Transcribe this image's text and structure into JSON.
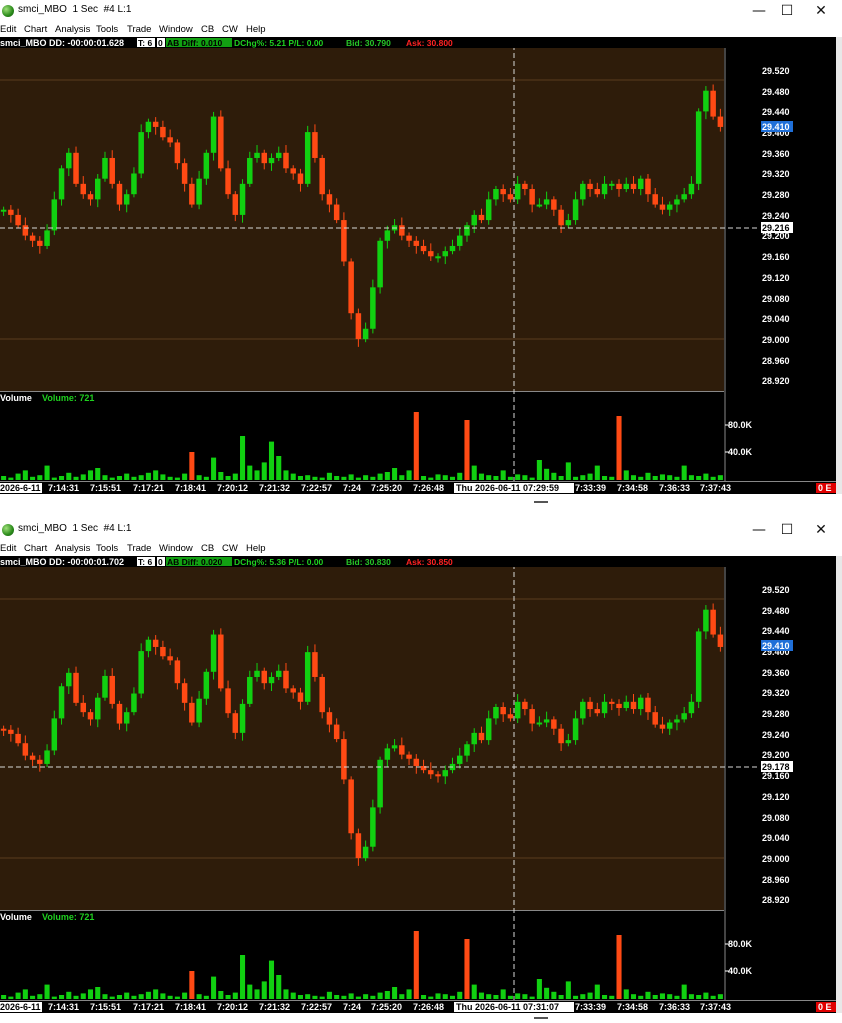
{
  "windows": [
    {
      "title": "smci_MBO  1 Sec  #4 L:1",
      "menu": [
        "Edit",
        "Chart",
        "Analysis",
        "Tools",
        "Trade",
        "Window",
        "CB",
        "CW",
        "Help"
      ],
      "header": {
        "name": "smci_MBO DD: -00:00:01.628",
        "t": "T: 6",
        "zero": "0",
        "ab_diff": "AB Diff: 0.010",
        "dchg": "DChg%: 5.21 P/L: 0.00",
        "bid": "Bid: 30.790",
        "ask": "Ask: 30.800"
      },
      "price_axis": [
        "29.520",
        "29.480",
        "29.440",
        "29.400",
        "29.360",
        "29.320",
        "29.280",
        "29.240",
        "29.200",
        "29.160",
        "29.120",
        "29.080",
        "29.040",
        "29.000",
        "28.960",
        "28.920"
      ],
      "last_price": "29.410",
      "cursor_price": "29.216",
      "volume_label": "Volume",
      "volume_value": "Volume: 721",
      "volume_axis": [
        "80.0K",
        "40.0K"
      ],
      "time_axis": [
        "2026-6-11",
        "7:14:31",
        "7:15:51",
        "7:17:21",
        "7:18:41",
        "7:20:12",
        "7:21:32",
        "7:22:57",
        "7:24",
        "7:25:20",
        "7:26:48",
        "7:33:39",
        "7:34:58",
        "7:36:33",
        "7:37:43"
      ],
      "cursor_time": "Thu 2026-06-11  07:29:59",
      "badge": "0 E",
      "controls": {
        "minimize": "—",
        "maximize": "☐",
        "close": "✕"
      }
    },
    {
      "title": "smci_MBO  1 Sec  #4 L:1",
      "menu": [
        "Edit",
        "Chart",
        "Analysis",
        "Tools",
        "Trade",
        "Window",
        "CB",
        "CW",
        "Help"
      ],
      "header": {
        "name": "smci_MBO DD: -00:00:01.702",
        "t": "T: 6",
        "zero": "0",
        "ab_diff": "AB Diff: 0.020",
        "dchg": "DChg%: 5.36 P/L: 0.00",
        "bid": "Bid: 30.830",
        "ask": "Ask: 30.850"
      },
      "price_axis": [
        "29.520",
        "29.480",
        "29.440",
        "29.400",
        "29.360",
        "29.320",
        "29.280",
        "29.240",
        "29.200",
        "29.160",
        "29.120",
        "29.080",
        "29.040",
        "29.000",
        "28.960",
        "28.920"
      ],
      "last_price": "29.410",
      "cursor_price": "29.178",
      "volume_label": "Volume",
      "volume_value": "Volume: 721",
      "volume_axis": [
        "80.0K",
        "40.0K"
      ],
      "time_axis": [
        "2026-6-11",
        "7:14:31",
        "7:15:51",
        "7:17:21",
        "7:18:41",
        "7:20:12",
        "7:21:32",
        "7:22:57",
        "7:24",
        "7:25:20",
        "7:26:48",
        "7:33:39",
        "7:34:58",
        "7:36:33",
        "7:37:43"
      ],
      "cursor_time": "Thu 2026-06-11  07:31:07",
      "badge": "0 E",
      "controls": {
        "minimize": "—",
        "maximize": "☐",
        "close": "✕"
      }
    }
  ],
  "price_path": [
    29.25,
    29.24,
    29.22,
    29.2,
    29.19,
    29.18,
    29.21,
    29.27,
    29.33,
    29.36,
    29.3,
    29.28,
    29.27,
    29.31,
    29.35,
    29.3,
    29.26,
    29.28,
    29.32,
    29.4,
    29.42,
    29.41,
    29.39,
    29.38,
    29.34,
    29.3,
    29.26,
    29.31,
    29.36,
    29.43,
    29.33,
    29.28,
    29.24,
    29.3,
    29.35,
    29.36,
    29.34,
    29.35,
    29.36,
    29.33,
    29.32,
    29.3,
    29.4,
    29.35,
    29.28,
    29.26,
    29.23,
    29.15,
    29.05,
    29.0,
    29.02,
    29.1,
    29.19,
    29.21,
    29.22,
    29.2,
    29.19,
    29.18,
    29.17,
    29.16,
    29.16,
    29.17,
    29.18,
    29.2,
    29.22,
    29.24,
    29.23,
    29.27,
    29.29,
    29.28,
    29.27,
    29.3,
    29.29,
    29.26,
    29.26,
    29.27,
    29.25,
    29.22,
    29.23,
    29.27,
    29.3,
    29.29,
    29.28,
    29.3,
    29.3,
    29.29,
    29.3,
    29.29,
    29.31,
    29.28,
    29.26,
    29.25,
    29.26,
    29.27,
    29.28,
    29.3,
    29.44,
    29.48,
    29.43,
    29.41
  ],
  "volume_path": [
    5,
    3,
    8,
    12,
    4,
    6,
    18,
    3,
    5,
    9,
    4,
    7,
    12,
    15,
    6,
    3,
    5,
    8,
    4,
    6,
    9,
    12,
    7,
    4,
    3,
    8,
    35,
    6,
    4,
    28,
    10,
    5,
    8,
    55,
    18,
    12,
    22,
    48,
    30,
    12,
    8,
    5,
    6,
    4,
    3,
    9,
    5,
    4,
    7,
    3,
    6,
    4,
    8,
    10,
    15,
    6,
    12,
    85,
    5,
    3,
    7,
    6,
    4,
    9,
    75,
    18,
    8,
    6,
    5,
    12,
    4,
    7,
    6,
    3,
    25,
    14,
    9,
    5,
    22,
    4,
    6,
    8,
    18,
    5,
    4,
    80,
    12,
    6,
    4,
    9,
    5,
    7,
    6,
    4,
    18,
    6,
    5,
    8,
    4,
    6
  ],
  "volume_red_index": [
    26,
    57,
    64,
    85
  ],
  "colors": {
    "chart_bg": "#2e1c0a",
    "up": "#11d011",
    "down": "#ff4a14",
    "crosshair": "#d7d7d7",
    "price_text": "#ffffff",
    "last_price_bg": "#1f6fd8",
    "ab_diff_bg": "#12a012",
    "dchg": "#1fd01f",
    "bid": "#27c527",
    "ask": "#ff2222",
    "badge_bg": "#e00000"
  }
}
